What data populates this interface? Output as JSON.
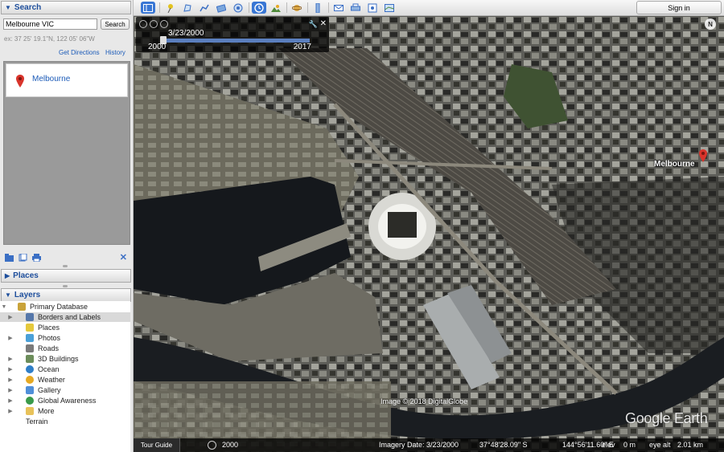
{
  "search": {
    "header": "Search",
    "query": "Melbourne VIC",
    "button_label": "Search",
    "example": "ex: 37 25' 19.1\"N, 122 05' 06\"W",
    "get_directions": "Get Directions",
    "history": "History",
    "results": [
      {
        "label": "Melbourne"
      }
    ]
  },
  "places": {
    "header": "Places"
  },
  "layers": {
    "header": "Layers",
    "items": [
      {
        "label": "Primary Database",
        "icon": "globe-db-icon"
      },
      {
        "label": "Borders and Labels",
        "icon": "flag-icon"
      },
      {
        "label": "Places",
        "icon": "places-icon"
      },
      {
        "label": "Photos",
        "icon": "photo-icon"
      },
      {
        "label": "Roads",
        "icon": "road-icon"
      },
      {
        "label": "3D Buildings",
        "icon": "building-icon"
      },
      {
        "label": "Ocean",
        "icon": "ocean-globe-icon"
      },
      {
        "label": "Weather",
        "icon": "sun-icon"
      },
      {
        "label": "Gallery",
        "icon": "star-icon"
      },
      {
        "label": "Global Awareness",
        "icon": "globe-icon"
      },
      {
        "label": "More",
        "icon": "folder-icon"
      },
      {
        "label": "Terrain",
        "icon": ""
      }
    ]
  },
  "toolbar": {
    "signin_label": "Sign in"
  },
  "time_slider": {
    "date": "3/23/2000",
    "start_year": "2000",
    "end_year": "2017"
  },
  "map": {
    "compass": "N",
    "place_label": "Melbourne",
    "copyright": "Image © 2018 DigitalGlobe",
    "watermark": "Google Earth"
  },
  "status": {
    "tour_guide": "Tour Guide",
    "history_year": "2000",
    "imagery_date": "Imagery Date: 3/23/2000",
    "latitude": "37°48'28.09\" S",
    "longitude": "144°56'11.60\" E",
    "elev_label": "elev",
    "elev_value": "0 m",
    "eye_alt_label": "eye alt",
    "eye_alt_value": "2.01 km"
  },
  "colors": {
    "accent": "#1d4e9c",
    "link": "#1c5bb8",
    "pin": "#d9342b",
    "toolbar_active": "#3876d4"
  }
}
